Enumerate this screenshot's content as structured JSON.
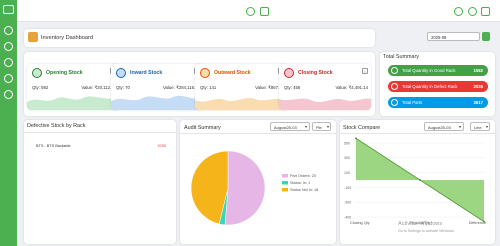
{
  "header": {
    "title": "Inventory Dashboard",
    "date_value": "2025-08"
  },
  "stats": [
    {
      "title": "Opening Stock",
      "qty": "Qty: 592",
      "value": "Value: ₹20,112.25",
      "color": "#2e7d32",
      "bg": "#c8ebcf"
    },
    {
      "title": "Inward Stock",
      "qty": "Qty: 70",
      "value": "Value: ₹284,116.12",
      "color": "#1565c0",
      "bg": "#c6dcf5"
    },
    {
      "title": "Outward Stock",
      "qty": "Qty: 141",
      "value": "Value: ₹867.67",
      "color": "#e65100",
      "bg": "#f9dcb0"
    },
    {
      "title": "Closing Stock",
      "qty": "Qty: 456",
      "value": "Value: ₹4,491.14",
      "color": "#c62828",
      "bg": "#f3c6d0"
    }
  ],
  "summary": {
    "title": "Total Summary",
    "items": [
      {
        "label": "Total Quantity in Good Rack",
        "value": "1582",
        "color": "#43a047",
        "icon": "check-icon"
      },
      {
        "label": "Total Quantity in Defect Rack",
        "value": "2035",
        "color": "#e53935",
        "icon": "warning-icon"
      },
      {
        "label": "Total Parts",
        "value": "3617",
        "color": "#039be5",
        "icon": "box-icon"
      }
    ]
  },
  "defective": {
    "title": "Defective Stock by Rack",
    "rows": [
      {
        "name": "BTS - BTS Backside",
        "value": "2035"
      }
    ]
  },
  "audit": {
    "title": "Audit Summary",
    "month": "August25-03",
    "chart_type": "Pie"
  },
  "compare": {
    "title": "Stock Compare",
    "month": "August25-03",
    "chart_type": "Line"
  },
  "watermark": {
    "line1": "Activate Windows",
    "line2": "Go to Settings to activate Windows."
  },
  "chart_data": [
    {
      "type": "pie",
      "series": [
        {
          "name": "Part Orders: 20",
          "value": 20,
          "color": "#e5b6e6"
        },
        {
          "name": "Status: In: 1",
          "value": 1,
          "color": "#3ad7b7"
        },
        {
          "name": "Status Not In: 18",
          "value": 18,
          "color": "#f4b41a"
        }
      ]
    },
    {
      "type": "area",
      "categories": [
        "Closing Qty",
        "Physical Qty",
        "Difference"
      ],
      "values": [
        450,
        0,
        -450
      ],
      "ylim": [
        -400,
        400
      ],
      "yticks": [
        "500",
        "300",
        "100",
        "-100",
        "-300",
        "-400"
      ],
      "color": "#7cc85a"
    }
  ]
}
